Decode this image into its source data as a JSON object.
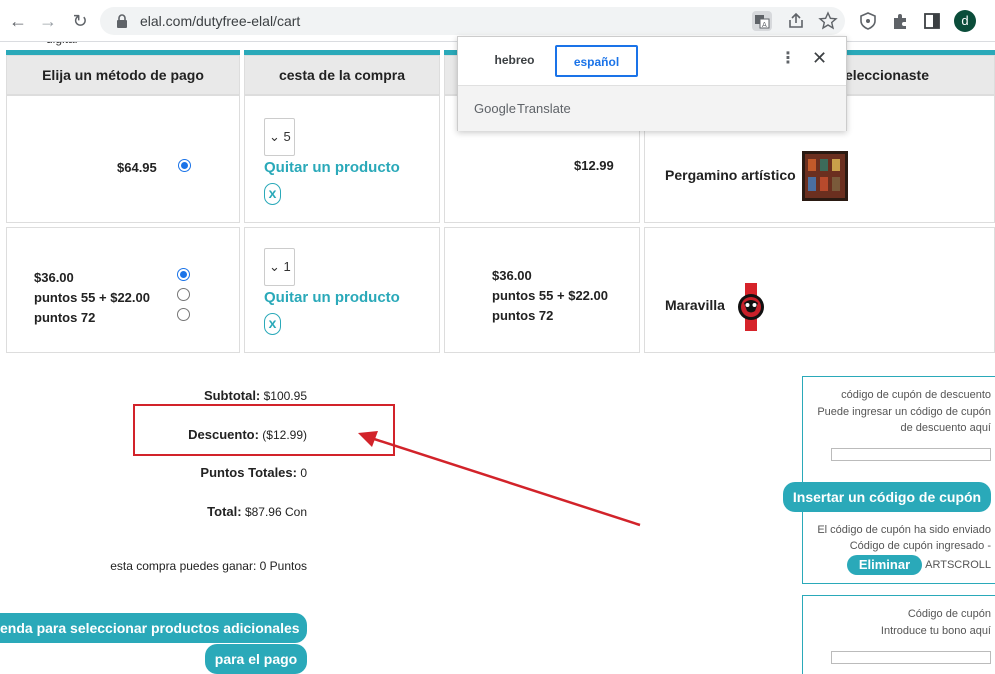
{
  "browser": {
    "url": "elal.com/dutyfree-elal/cart",
    "avatar_letter": "d"
  },
  "page": {
    "cut_text": "digital"
  },
  "table": {
    "headers": [
      "Elija un método de pago",
      "cesta de la compra",
      "",
      "eleccionaste"
    ],
    "rows": [
      {
        "payment": "$64.95",
        "qty": "5",
        "remove": "Quitar un producto",
        "x": "x",
        "price": "$12.99",
        "product": "Pergamino artístico"
      },
      {
        "payment_lines": [
          "$36.00",
          "puntos 55 + $22.00",
          "puntos 72"
        ],
        "qty": "1",
        "remove": "Quitar un producto",
        "x": "x",
        "price_lines": [
          "$36.00",
          "puntos 55 + $22.00",
          "puntos 72"
        ],
        "product": "Maravilla"
      }
    ]
  },
  "summary": {
    "subtotal_label": "Subtotal:",
    "subtotal_value": "$100.95",
    "discount_label": "Descuento:",
    "discount_value": "($12.99)",
    "points_label": "Puntos Totales:",
    "points_value": "0",
    "total_label": "Total:",
    "total_value": "$87.96 Con",
    "earn_text": "esta compra puedes ganar: 0 Puntos"
  },
  "buttons": {
    "continue_shopping": "enda para seleccionar productos adicionales",
    "to_payment": "para el pago"
  },
  "coupon": {
    "title": "código de cupón de descuento",
    "hint_line1": "Puede ingresar un código de cupón",
    "hint_line2": "de descuento aquí",
    "insert_button": "Insertar un código de cupón",
    "sent_text": "El código de cupón ha sido enviado",
    "entered_text": "Código de cupón ingresado -",
    "remove_button": "Eliminar",
    "code": "ARTSCROLL"
  },
  "voucher": {
    "title": "Código de cupón",
    "hint": "Introduce tu bono aquí"
  },
  "translate": {
    "tab_source": "hebreo",
    "tab_target": "español",
    "brand": "Google",
    "brand_suffix": "Translate"
  },
  "colors": {
    "accent": "#2aa9b9",
    "annotation": "#d2232a",
    "translate_blue": "#1a73e8"
  }
}
